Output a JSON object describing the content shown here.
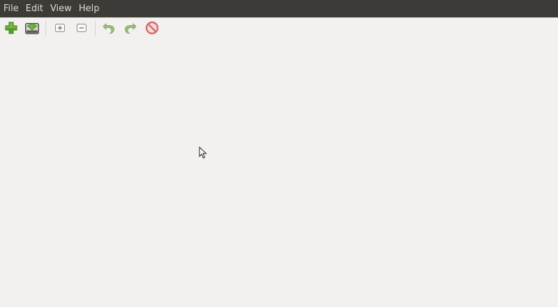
{
  "menubar": {
    "items": [
      {
        "label": "File"
      },
      {
        "label": "Edit"
      },
      {
        "label": "View"
      },
      {
        "label": "Help"
      }
    ]
  },
  "toolbar": {
    "buttons": [
      {
        "icon": "add-icon"
      },
      {
        "icon": "save-download-icon"
      },
      {
        "icon": "expand-icon"
      },
      {
        "icon": "collapse-icon"
      },
      {
        "icon": "undo-icon"
      },
      {
        "icon": "redo-icon"
      },
      {
        "icon": "stop-icon"
      }
    ]
  },
  "colors": {
    "menubar_bg": "#3c3b37",
    "menubar_text": "#dfdbd2",
    "window_bg": "#f2f1f0",
    "add_green": "#5aa02c",
    "disabled_green": "#9dbd7a",
    "stop_red": "#d96a6a"
  }
}
